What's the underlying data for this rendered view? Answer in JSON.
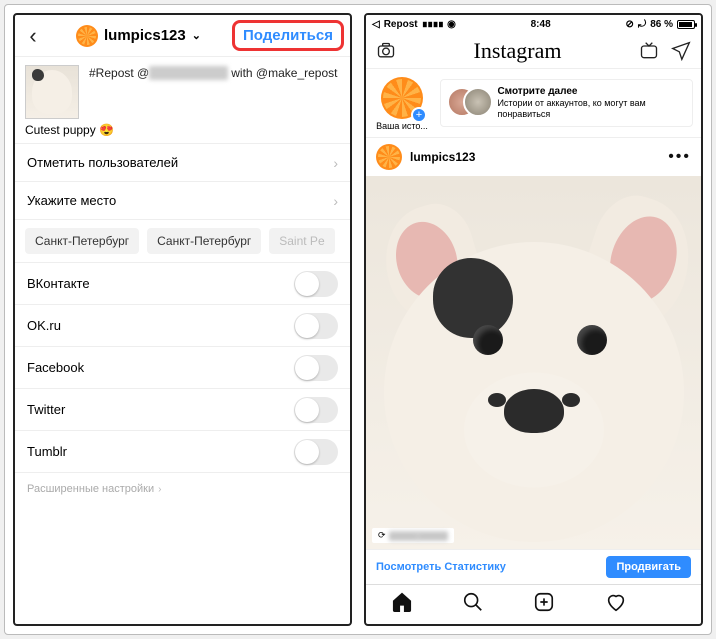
{
  "leftPhone": {
    "username": "lumpics123",
    "shareButton": "Поделиться",
    "caption": {
      "line1_prefix": "#Repost @",
      "line1_blurred": "xxxxxx_xxxxxx",
      "line1_suffix": " with @make_repost",
      "line2": "Cutest puppy 😍"
    },
    "tagUsers": "Отметить пользователей",
    "addLocation": "Укажите место",
    "locationChips": [
      "Санкт-Петербург",
      "Санкт-Петербург",
      "Saint Pe"
    ],
    "shareTargets": [
      {
        "name": "ВКонтакте",
        "on": false
      },
      {
        "name": "OK.ru",
        "on": false
      },
      {
        "name": "Facebook",
        "on": false
      },
      {
        "name": "Twitter",
        "on": false
      },
      {
        "name": "Tumblr",
        "on": false
      }
    ],
    "advanced": "Расширенные настройки"
  },
  "rightPhone": {
    "statusBar": {
      "backApp": "Repost",
      "time": "8:48",
      "batteryPct": "86 %"
    },
    "appName": "Instagram",
    "yourStoryLabel": "Ваша исто...",
    "suggest": {
      "title": "Смотрите далее",
      "subtitle": "Истории от аккаунтов, ко могут вам понравиться"
    },
    "post": {
      "username": "lumpics123",
      "repostBadgeUser": "xxxxxx_xxxxxx",
      "statsLink": "Посмотреть Статистику",
      "promote": "Продвигать"
    }
  }
}
